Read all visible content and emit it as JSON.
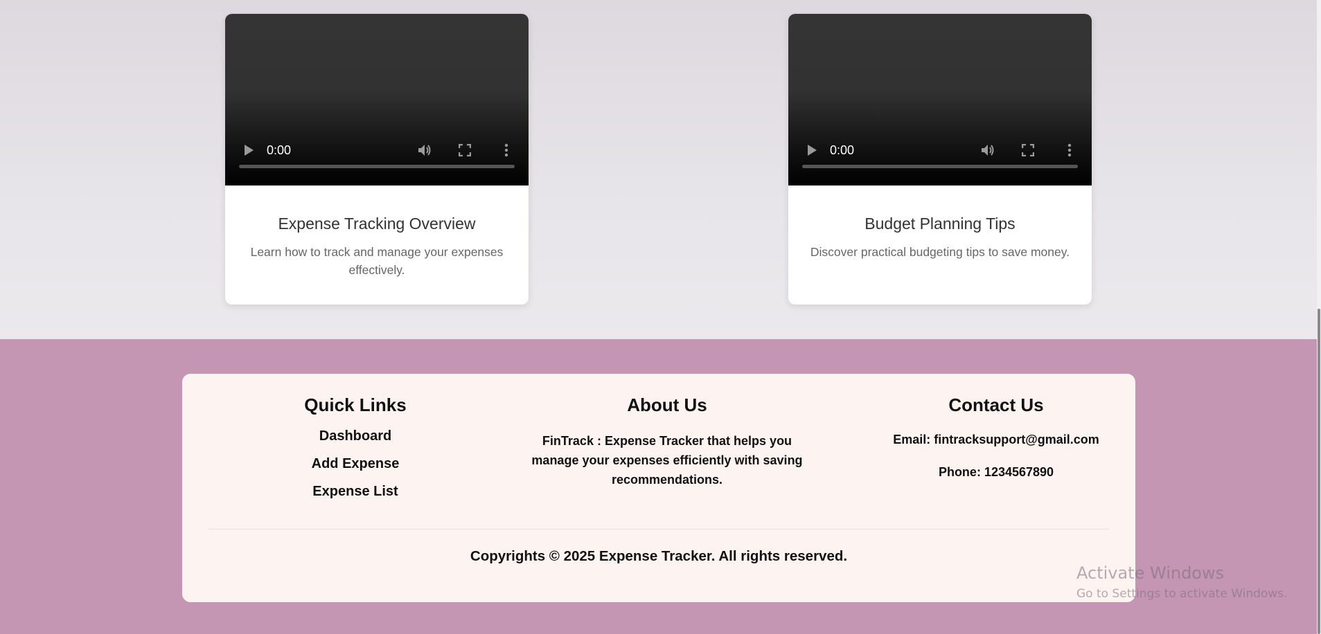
{
  "videos": [
    {
      "title": "Expense Tracking Overview",
      "description": "Learn how to track and manage your expenses effectively.",
      "time": "0:00",
      "icons": [
        "play-icon",
        "volume-icon",
        "fullscreen-icon",
        "more-options-icon"
      ]
    },
    {
      "title": "Budget Planning Tips",
      "description": "Discover practical budgeting tips to save money.",
      "time": "0:00",
      "icons": [
        "play-icon",
        "volume-icon",
        "fullscreen-icon",
        "more-options-icon"
      ]
    }
  ],
  "footer": {
    "quick_links": {
      "heading": "Quick Links",
      "items": [
        "Dashboard",
        "Add Expense",
        "Expense List"
      ]
    },
    "about": {
      "heading": "About Us",
      "text": "FinTrack : Expense Tracker that helps you manage your expenses efficiently with saving recommendations."
    },
    "contact": {
      "heading": "Contact Us",
      "email": "Email: fintracksupport@gmail.com",
      "phone": "Phone: 1234567890"
    },
    "copyright": "Copyrights © 2025 Expense Tracker. All rights reserved."
  },
  "watermark": {
    "title": "Activate Windows",
    "subtitle": "Go to Settings to activate Windows."
  },
  "colors": {
    "footer_background": "#c596b4",
    "footer_card": "#fdf3f1",
    "page_background": "#e7e5e9"
  }
}
